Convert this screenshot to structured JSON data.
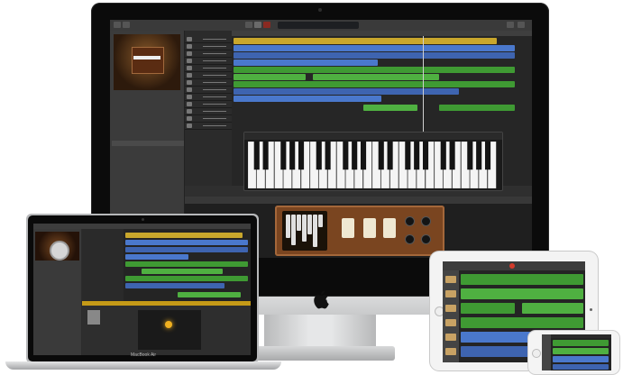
{
  "devices": {
    "macbook": {
      "label": "MacBook Air"
    }
  },
  "colors": {
    "region_green": "#3f9a33",
    "region_blue": "#3e64b0",
    "region_yellow": "#c9a72c",
    "organ_wood": "#7a4520",
    "record_red": "#d23b2b"
  },
  "icons": [
    "apple-logo-icon",
    "record-icon",
    "play-icon",
    "instrument-icon"
  ]
}
